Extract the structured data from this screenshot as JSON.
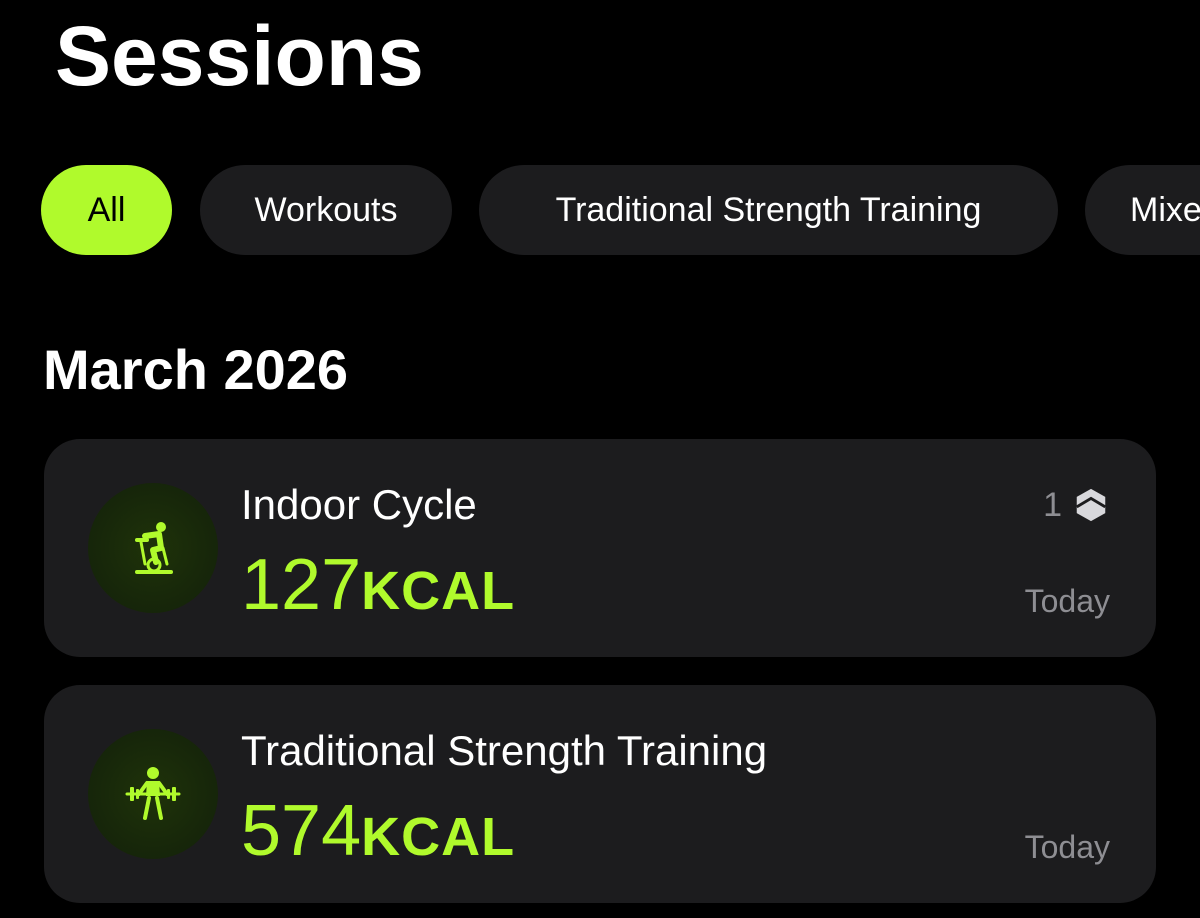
{
  "header": {
    "title": "Sessions"
  },
  "filters": [
    {
      "label": "All",
      "active": true
    },
    {
      "label": "Workouts",
      "active": false
    },
    {
      "label": "Traditional Strength Training",
      "active": false
    },
    {
      "label": "Mixed Cardio",
      "active": false
    }
  ],
  "colors": {
    "accent": "#b0fa2c",
    "card_bg": "#1c1c1e",
    "secondary_text": "#8e8e93",
    "background": "#000000"
  },
  "section": {
    "heading": "March 2026",
    "sessions": [
      {
        "title": "Indoor Cycle",
        "value": "127",
        "unit": "KCAL",
        "date": "Today",
        "badge_count": "1",
        "icon": "indoor-cycle-icon",
        "badge_icon": "hexagon-badge-icon"
      },
      {
        "title": "Traditional Strength Training",
        "value": "574",
        "unit": "KCAL",
        "date": "Today",
        "icon": "strength-training-icon"
      }
    ]
  }
}
